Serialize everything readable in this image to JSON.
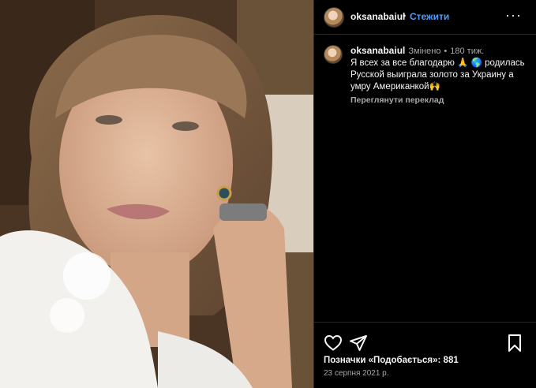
{
  "post": {
    "author": {
      "username": "oksanabaiul",
      "follow_label": "Стежити",
      "separator": "•"
    },
    "menu_icon": "more-horizontal-icon",
    "caption": {
      "username": "oksanabaiul",
      "edited_label": "Змінено",
      "separator": "•",
      "age": "180 тиж.",
      "text": "Я всех за все благодарю 🙏 🌎 родилась Русской выиграла золото за Украину а умру Американкой🙌",
      "translate_label": "Переглянути переклад"
    },
    "actions": {
      "icons": [
        "heart-icon",
        "share-icon",
        "bookmark-icon"
      ]
    },
    "likes_text": "Позначки «Подобається»: 881",
    "date": "23 серпня 2021 р."
  }
}
